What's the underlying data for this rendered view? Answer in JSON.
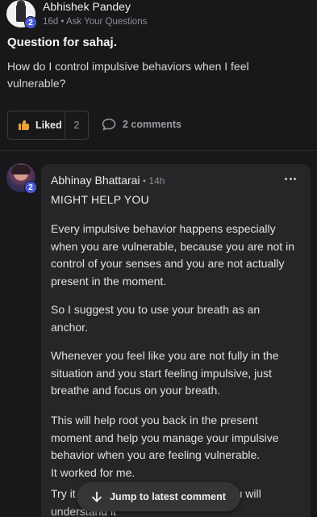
{
  "post": {
    "author": "Abhishek Pandey",
    "author_level": "2",
    "meta": "16d • Ask Your Questions",
    "title": "Question for sahaj.",
    "body": "How do I control impulsive behaviors when I feel vulnerable?",
    "like_label": "Liked",
    "like_count": "2",
    "comments_label": "2 comments",
    "like_icon": "thumbs-up-icon",
    "comment_icon": "speech-bubble-icon",
    "accent_color": "#e8a33d"
  },
  "comment": {
    "author": "Abhinay Bhattarai",
    "time": " • 14h",
    "author_level": "2",
    "heading": "MIGHT HELP YOU",
    "paragraphs": [
      "Every impulsive behavior happens especially when you are vulnerable, because you are not in control of your senses and you are not actually present in the moment.",
      "So I suggest you to use your breath as an anchor.",
      "Whenever you feel like you are not fully in the situation and you start feeling impulsive, just breathe and focus on your breath.",
      "This will help root you back in the present moment and help you manage your impulsive behavior when you are feeling vulnerable.\nIt worked for me."
    ],
    "partial_line_start": "Try it",
    "partial_line_end": "u will",
    "partial_line_next": "understand it"
  },
  "jump_button": {
    "label": "Jump to latest comment",
    "icon": "arrow-down-icon"
  },
  "colors": {
    "background": "#18181a",
    "card": "#262628",
    "badge": "#4a5ad6"
  }
}
